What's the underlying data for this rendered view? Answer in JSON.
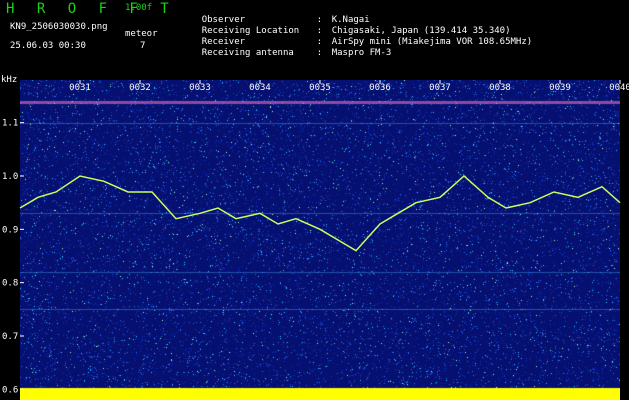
{
  "header": {
    "brand": "H R O F F T",
    "version": "1.00f",
    "filename": "KN9_2506030030.png",
    "datetime": "25.06.03 00:30",
    "mode_label": "meteor",
    "count": "7"
  },
  "meta": [
    {
      "key": "Observer",
      "value": "K.Nagai"
    },
    {
      "key": "Receiving Location",
      "value": "Chigasaki, Japan (139.414 35.340)"
    },
    {
      "key": "Receiver",
      "value": "AirSpy mini (Miakejima VOR 108.65MHz)"
    },
    {
      "key": "Receiving antenna",
      "value": "Maspro FM-3"
    }
  ],
  "colors": {
    "background": "#000000",
    "brand": "#19d219",
    "noise_low": "#0a1aa0",
    "noise_high": "#1fe0ff",
    "trace": "#c8ff60",
    "baseline": "#ffff00"
  },
  "chart_data": {
    "type": "heatmap",
    "ylabel": "kHz",
    "yticks": [
      "1.1",
      "1.0",
      "0.9",
      "0.8",
      "0.7",
      "0.6"
    ],
    "ylim": [
      0.58,
      1.18
    ],
    "xticks": [
      "0031",
      "0032",
      "0033",
      "0034",
      "0035",
      "0036",
      "0037",
      "0038",
      "0039",
      "0040"
    ],
    "xlim": [
      30,
      40
    ],
    "carrier_lines_khz": [
      1.14,
      1.1,
      0.93,
      0.82,
      0.75
    ],
    "trace": {
      "x": [
        30.0,
        30.3,
        30.6,
        31.0,
        31.4,
        31.8,
        32.2,
        32.6,
        33.0,
        33.3,
        33.6,
        34.0,
        34.3,
        34.6,
        35.0,
        35.3,
        35.6,
        36.0,
        36.3,
        36.6,
        37.0,
        37.4,
        37.8,
        38.1,
        38.5,
        38.9,
        39.3,
        39.7,
        40.0
      ],
      "y": [
        0.94,
        0.96,
        0.97,
        1.0,
        0.99,
        0.97,
        0.97,
        0.92,
        0.93,
        0.94,
        0.92,
        0.93,
        0.91,
        0.92,
        0.9,
        0.88,
        0.86,
        0.91,
        0.93,
        0.95,
        0.96,
        1.0,
        0.96,
        0.94,
        0.95,
        0.97,
        0.96,
        0.98,
        0.95
      ]
    }
  }
}
